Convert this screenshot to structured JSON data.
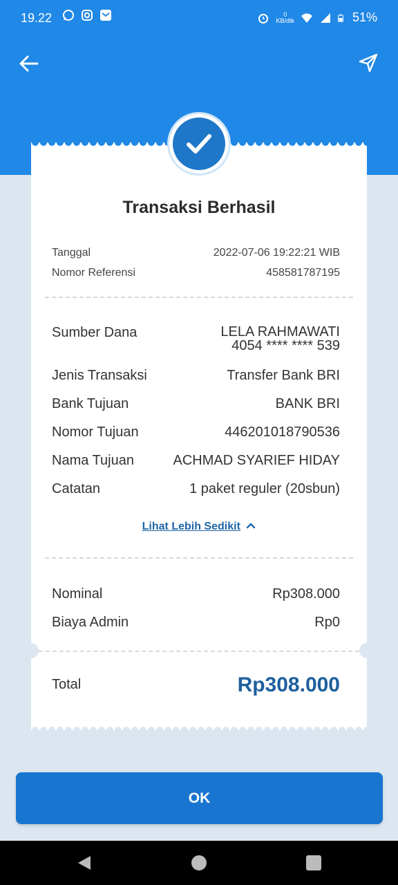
{
  "status_bar": {
    "time": "19.22",
    "net_speed_value": "0",
    "net_speed_unit": "KB/dtk",
    "battery": "51%"
  },
  "receipt": {
    "title": "Transaksi Berhasil",
    "meta": [
      {
        "label": "Tanggal",
        "value": "2022-07-06 19:22:21 WIB"
      },
      {
        "label": "Nomor Referensi",
        "value": "458581787195"
      }
    ],
    "details": {
      "source_label": "Sumber Dana",
      "source_name": "LELA RAHMAWATI",
      "source_account": "4054 **** **** 539",
      "rows": [
        {
          "label": "Jenis Transaksi",
          "value": "Transfer Bank BRI"
        },
        {
          "label": "Bank Tujuan",
          "value": "BANK BRI"
        },
        {
          "label": "Nomor Tujuan",
          "value": "446201018790536"
        },
        {
          "label": "Nama Tujuan",
          "value": "ACHMAD SYARIEF HIDAY"
        },
        {
          "label": "Catatan",
          "value": "1 paket reguler (20sbun)"
        }
      ]
    },
    "toggle_label": "Lihat Lebih Sedikit",
    "amounts": [
      {
        "label": "Nominal",
        "value": "Rp308.000"
      },
      {
        "label": "Biaya Admin",
        "value": "Rp0"
      }
    ],
    "total_label": "Total",
    "total_value": "Rp308.000"
  },
  "ok_label": "OK",
  "icons": {
    "back": "arrow-left-icon",
    "share": "send-icon",
    "success": "checkmark-icon"
  },
  "colors": {
    "header": "#2088e6",
    "accent": "#1976d0",
    "total": "#1e5f9e",
    "background": "#dce6f0"
  }
}
